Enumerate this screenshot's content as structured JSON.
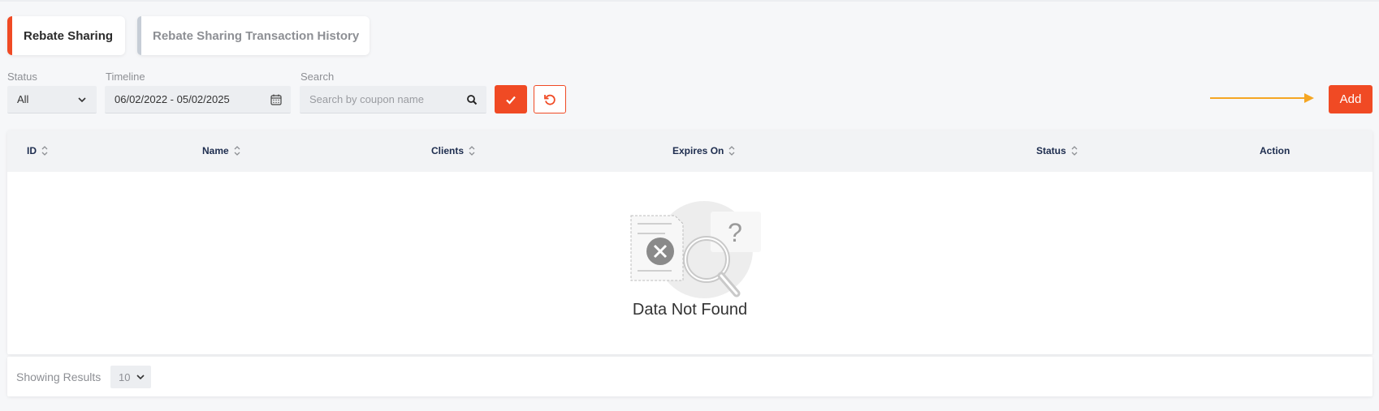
{
  "tabs": [
    {
      "label": "Rebate Sharing",
      "active": true
    },
    {
      "label": "Rebate Sharing Transaction History",
      "active": false
    }
  ],
  "filters": {
    "status": {
      "label": "Status",
      "value": "All"
    },
    "timeline": {
      "label": "Timeline",
      "value": "06/02/2022 - 05/02/2025"
    },
    "search": {
      "label": "Search",
      "placeholder": "Search by coupon name"
    }
  },
  "toolbar": {
    "add_label": "Add"
  },
  "table": {
    "columns": [
      "ID",
      "Name",
      "Clients",
      "Expires On",
      "Status",
      "Action"
    ],
    "empty_message": "Data Not Found"
  },
  "footer": {
    "showing_label": "Showing Results",
    "page_size": "10"
  },
  "colors": {
    "accent": "#f04a24",
    "arrow": "#f5a623",
    "header_text": "#1d2c4e"
  }
}
